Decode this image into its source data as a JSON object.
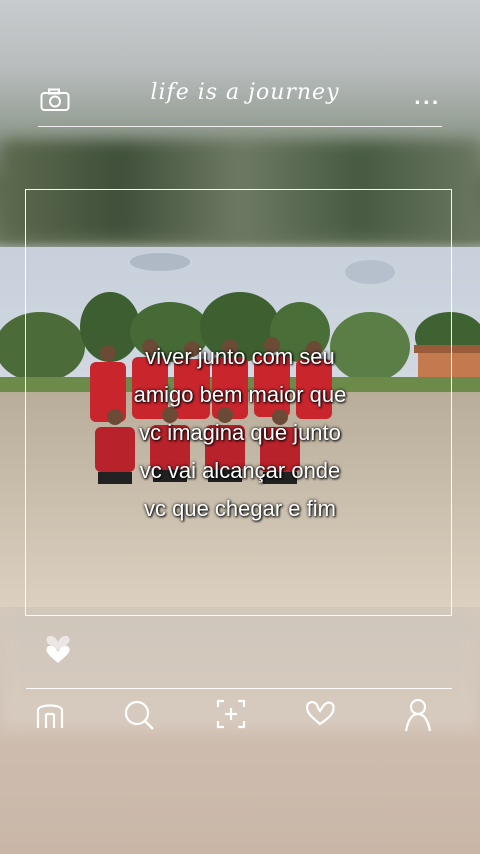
{
  "header": {
    "title": "life is a journey",
    "camera_icon": "camera-icon",
    "more_icon": "more-dots-icon",
    "more_text": "..."
  },
  "post": {
    "caption_lines": [
      "viver junto com seu",
      "amigo bem maior que",
      "vc imagina que junto",
      "vc vai alcançar onde",
      "vc  que  chegar e fim"
    ]
  },
  "actions": {
    "like_icon": "heart-icon"
  },
  "bottom_nav": {
    "items": [
      "home-icon",
      "search-icon",
      "add-post-icon",
      "favorites-icon",
      "profile-icon"
    ]
  }
}
